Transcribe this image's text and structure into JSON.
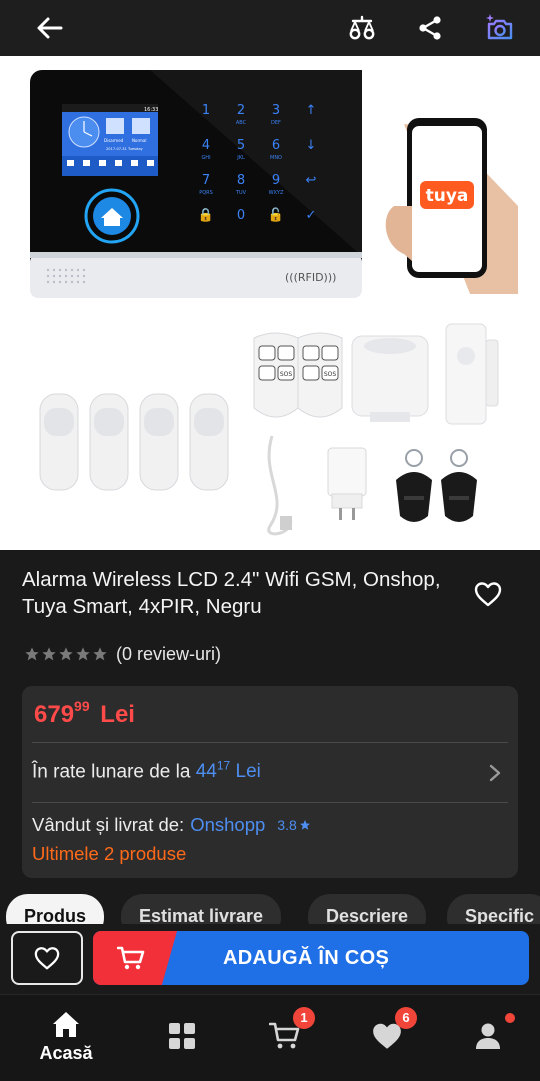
{
  "product": {
    "title": "Alarma Wireless LCD 2.4\" Wifi GSM, Onshop, Tuya Smart, 4xPIR, Negru",
    "rating_text": "(0 review-uri)",
    "stars": 0,
    "image_dots": 5,
    "image_active_index": 0,
    "image_texts": {
      "panel_brand": "(((RFID)))",
      "phone_brand": "tuya",
      "keypad": [
        "1",
        "2",
        "3",
        "↑",
        "4",
        "5",
        "6",
        "↓",
        "7",
        "8",
        "9",
        "↩",
        "🔒",
        "0",
        "🔓",
        "✓"
      ],
      "keypad_letters": [
        "",
        "ABC",
        "DEF",
        "",
        "GHI",
        "JKL",
        "MNO",
        "",
        "PQRS",
        "TUV",
        "WXYZ",
        "",
        "",
        "",
        "",
        ""
      ],
      "screen_time": "16:33",
      "screen_date": "2017-07-31  Tuesday",
      "screen_tiles": [
        "Disarmed",
        "Normal"
      ],
      "screen_icons": [
        "Call",
        "Arm",
        "SOS",
        "Set",
        "Disarm",
        "Menu"
      ],
      "remote_labels": [
        "SOS",
        "SOS"
      ]
    }
  },
  "price_card": {
    "price_int": "679",
    "price_dec": "99",
    "currency": "Lei",
    "rate_prefix": "În rate lunare de la",
    "rate_int": "44",
    "rate_dec": "17",
    "rate_currency": "Lei",
    "sold_label": "Vândut și livrat de:",
    "seller": "Onshopp",
    "seller_rating": "3.8",
    "stock_text": "Ultimele 2 produse"
  },
  "tabs": [
    {
      "label": "Produs",
      "active": true
    },
    {
      "label": "Estimat livrare",
      "active": false
    },
    {
      "label": "Descriere",
      "active": false
    },
    {
      "label": "Specific",
      "active": false
    }
  ],
  "cart": {
    "add_label": "ADAUGĂ ÎN COȘ"
  },
  "nav": [
    {
      "label": "Acasă",
      "icon": "home-icon",
      "badge": ""
    },
    {
      "label": "",
      "icon": "categories-icon",
      "badge": ""
    },
    {
      "label": "",
      "icon": "cart-icon",
      "badge": "1"
    },
    {
      "label": "",
      "icon": "favorites-icon",
      "badge": "6"
    },
    {
      "label": "",
      "icon": "account-icon",
      "badge": ""
    }
  ],
  "colors": {
    "price": "#ff4a4a",
    "link": "#4d8ef0",
    "stock": "#ff6a1a",
    "add_button": "#1f6fe6",
    "add_button_accent": "#f2303a",
    "badge": "#f2453a"
  }
}
